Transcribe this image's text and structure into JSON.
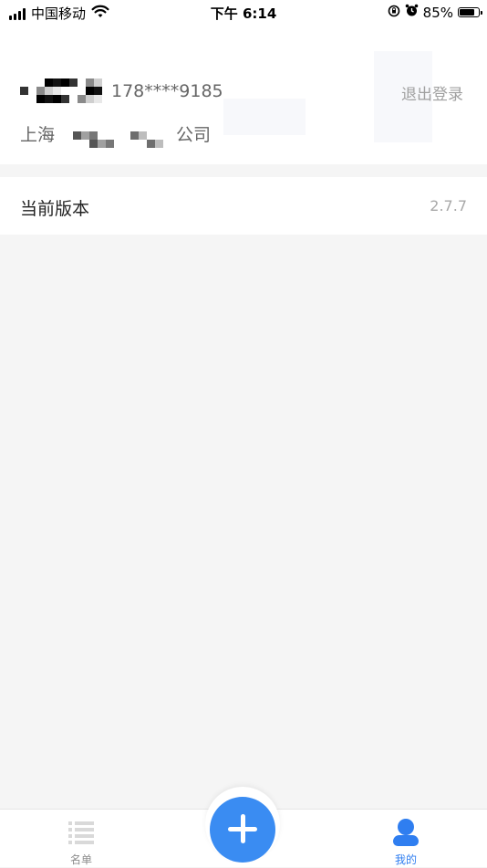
{
  "status_bar": {
    "carrier": "中国移动",
    "time": "下午 6:14",
    "battery_percent": "85%",
    "battery_level": 0.85,
    "icons": [
      "signal-icon",
      "wifi-icon",
      "rotation-lock-icon",
      "alarm-icon",
      "battery-icon"
    ]
  },
  "profile": {
    "phone": "178****9185",
    "company_prefix": "上海",
    "company_suffix": "公司",
    "logout_label": "退出登录"
  },
  "settings": {
    "version_label": "当前版本",
    "version_value": "2.7.7"
  },
  "tab_bar": {
    "list_label": "名单",
    "mine_label": "我的",
    "add_icon": "plus-icon"
  },
  "colors": {
    "accent": "#2f7ef0",
    "add_button": "#3a8cf2",
    "page_background": "#f5f5f5",
    "muted_text": "#a0a0a0"
  }
}
